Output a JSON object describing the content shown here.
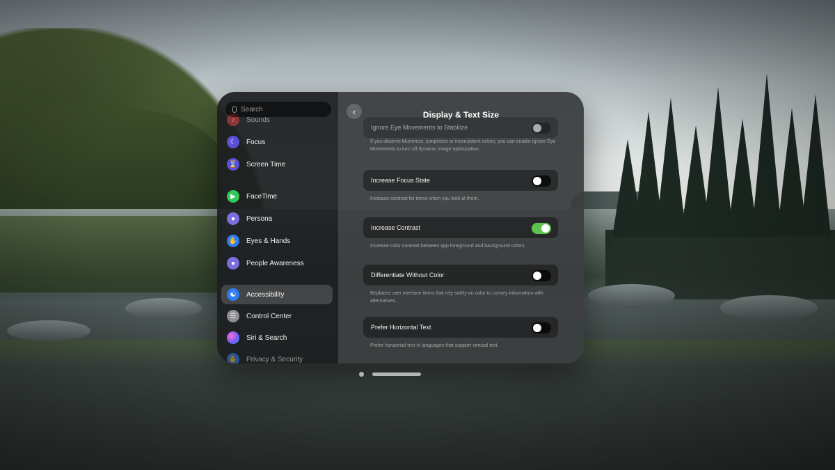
{
  "search": {
    "placeholder": "Search"
  },
  "sidebar": {
    "items": [
      {
        "label": "Sounds",
        "icon": "speaker-icon",
        "color": "#e0443f",
        "selected": false
      },
      {
        "label": "Focus",
        "icon": "moon-icon",
        "color": "#5b4fd8",
        "selected": false
      },
      {
        "label": "Screen Time",
        "icon": "hourglass-icon",
        "color": "#5b4fd8",
        "selected": false
      },
      {
        "label": "FaceTime",
        "icon": "video-camera-icon",
        "color": "#34c759",
        "selected": false
      },
      {
        "label": "Persona",
        "icon": "person-icon",
        "color": "#7b6fe0",
        "selected": false
      },
      {
        "label": "Eyes & Hands",
        "icon": "hand-icon",
        "color": "#2f7cf6",
        "selected": false
      },
      {
        "label": "People Awareness",
        "icon": "people-icon",
        "color": "#7b6fe0",
        "selected": false
      },
      {
        "label": "Accessibility",
        "icon": "accessibility-icon",
        "color": "#2f7cf6",
        "selected": true
      },
      {
        "label": "Control Center",
        "icon": "toggles-icon",
        "color": "#8e8e93",
        "selected": false
      },
      {
        "label": "Siri & Search",
        "icon": "siri-icon",
        "color": "#9b59d0",
        "selected": false
      },
      {
        "label": "Privacy & Security",
        "icon": "hand-raised-icon",
        "color": "#2f7cf6",
        "selected": false
      }
    ]
  },
  "detail": {
    "title": "Display & Text Size",
    "settings": [
      {
        "label": "Ignore Eye Movements to Stabilize",
        "on": false,
        "description": "If you observe blurriness, jumpiness or inconsistent colors, you can enable Ignore Eye Movements to turn off dynamic image optimization."
      },
      {
        "label": "Increase Focus State",
        "on": false,
        "description": "Increase contrast for items when you look at them."
      },
      {
        "label": "Increase Contrast",
        "on": true,
        "description": "Increase color contrast between app foreground and background colors."
      },
      {
        "label": "Differentiate Without Color",
        "on": false,
        "description": "Replaces user interface items that rely solely on color to convey information with alternatives."
      },
      {
        "label": "Prefer Horizontal Text",
        "on": false,
        "description": "Prefer horizontal text in languages that support vertical text."
      }
    ]
  },
  "colors": {
    "toggle_on": "#5cc44e",
    "accent": "#2f7cf6"
  }
}
